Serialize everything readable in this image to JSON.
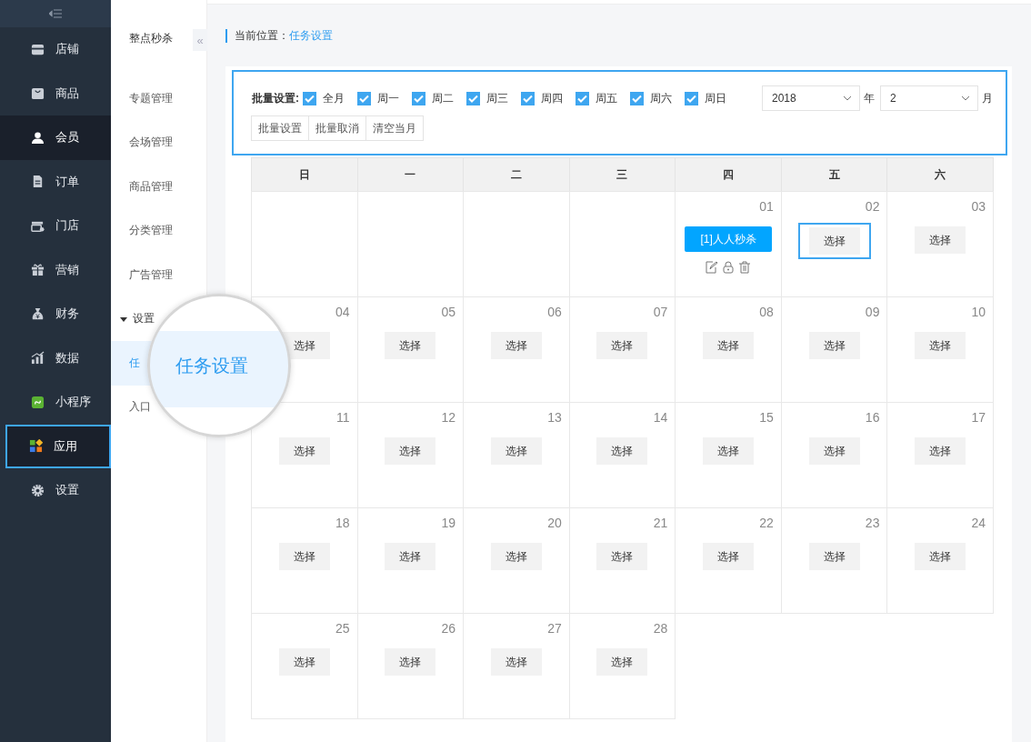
{
  "sidebar": {
    "items": [
      {
        "label": "店铺",
        "selected": false,
        "highlighted": false
      },
      {
        "label": "商品",
        "selected": false,
        "highlighted": false
      },
      {
        "label": "会员",
        "selected": true,
        "highlighted": false
      },
      {
        "label": "订单",
        "selected": false,
        "highlighted": false
      },
      {
        "label": "门店",
        "selected": false,
        "highlighted": false
      },
      {
        "label": "营销",
        "selected": false,
        "highlighted": false
      },
      {
        "label": "财务",
        "selected": false,
        "highlighted": false
      },
      {
        "label": "数据",
        "selected": false,
        "highlighted": false
      },
      {
        "label": "小程序",
        "selected": false,
        "highlighted": false
      },
      {
        "label": "应用",
        "selected": true,
        "highlighted": true
      },
      {
        "label": "设置",
        "selected": false,
        "highlighted": false
      }
    ]
  },
  "submenu": {
    "title": "整点秒杀",
    "collapse_icon": "«",
    "items": [
      {
        "kind": "item",
        "label": "专题管理",
        "selected": false
      },
      {
        "kind": "item",
        "label": "会场管理",
        "selected": false
      },
      {
        "kind": "item",
        "label": "商品管理",
        "selected": false
      },
      {
        "kind": "item",
        "label": "分类管理",
        "selected": false
      },
      {
        "kind": "item",
        "label": "广告管理",
        "selected": false
      },
      {
        "kind": "group",
        "label": "设置",
        "expanded": true
      },
      {
        "kind": "item",
        "label": "任",
        "selected": true
      },
      {
        "kind": "item",
        "label": "入口",
        "selected": false
      }
    ]
  },
  "magnifier": {
    "text": "任务设置"
  },
  "breadcrumb": {
    "label": "当前位置：",
    "current": "任务设置"
  },
  "batch": {
    "highlighted": true,
    "label": "批量设置:",
    "options": [
      {
        "label": "全月",
        "checked": true
      },
      {
        "label": "周一",
        "checked": true
      },
      {
        "label": "周二",
        "checked": true
      },
      {
        "label": "周三",
        "checked": true
      },
      {
        "label": "周四",
        "checked": true
      },
      {
        "label": "周五",
        "checked": true
      },
      {
        "label": "周六",
        "checked": true
      },
      {
        "label": "周日",
        "checked": true
      }
    ],
    "year": {
      "value": "2018",
      "unit": "年"
    },
    "month": {
      "value": "2",
      "unit": "月"
    },
    "buttons": [
      "批量设置",
      "批量取消",
      "清空当月"
    ]
  },
  "calendar": {
    "weekdays": [
      "日",
      "一",
      "二",
      "三",
      "四",
      "五",
      "六"
    ],
    "cells": [
      {
        "kind": "blank"
      },
      {
        "kind": "blank"
      },
      {
        "kind": "blank"
      },
      {
        "kind": "blank"
      },
      {
        "kind": "event",
        "date": "01",
        "event": "[1]人人秒杀"
      },
      {
        "kind": "day",
        "date": "02",
        "button": "选择",
        "highlighted": true
      },
      {
        "kind": "day",
        "date": "03",
        "button": "选择",
        "highlighted": false
      },
      {
        "kind": "day",
        "date": "04",
        "button": "选择",
        "highlighted": false
      },
      {
        "kind": "day",
        "date": "05",
        "button": "选择",
        "highlighted": false
      },
      {
        "kind": "day",
        "date": "06",
        "button": "选择",
        "highlighted": false
      },
      {
        "kind": "day",
        "date": "07",
        "button": "选择",
        "highlighted": false
      },
      {
        "kind": "day",
        "date": "08",
        "button": "选择",
        "highlighted": false
      },
      {
        "kind": "day",
        "date": "09",
        "button": "选择",
        "highlighted": false
      },
      {
        "kind": "day",
        "date": "10",
        "button": "选择",
        "highlighted": false
      },
      {
        "kind": "day",
        "date": "11",
        "button": "选择",
        "highlighted": false
      },
      {
        "kind": "day",
        "date": "12",
        "button": "选择",
        "highlighted": false
      },
      {
        "kind": "day",
        "date": "13",
        "button": "选择",
        "highlighted": false
      },
      {
        "kind": "day",
        "date": "14",
        "button": "选择",
        "highlighted": false
      },
      {
        "kind": "day",
        "date": "15",
        "button": "选择",
        "highlighted": false
      },
      {
        "kind": "day",
        "date": "16",
        "button": "选择",
        "highlighted": false
      },
      {
        "kind": "day",
        "date": "17",
        "button": "选择",
        "highlighted": false
      },
      {
        "kind": "day",
        "date": "18",
        "button": "选择",
        "highlighted": false
      },
      {
        "kind": "day",
        "date": "19",
        "button": "选择",
        "highlighted": false
      },
      {
        "kind": "day",
        "date": "20",
        "button": "选择",
        "highlighted": false
      },
      {
        "kind": "day",
        "date": "21",
        "button": "选择",
        "highlighted": false
      },
      {
        "kind": "day",
        "date": "22",
        "button": "选择",
        "highlighted": false
      },
      {
        "kind": "day",
        "date": "23",
        "button": "选择",
        "highlighted": false
      },
      {
        "kind": "day",
        "date": "24",
        "button": "选择",
        "highlighted": false
      },
      {
        "kind": "day",
        "date": "25",
        "button": "选择",
        "highlighted": false
      },
      {
        "kind": "day",
        "date": "26",
        "button": "选择",
        "highlighted": false
      },
      {
        "kind": "day",
        "date": "27",
        "button": "选择",
        "highlighted": false
      },
      {
        "kind": "day",
        "date": "28",
        "button": "选择",
        "highlighted": false
      }
    ]
  }
}
